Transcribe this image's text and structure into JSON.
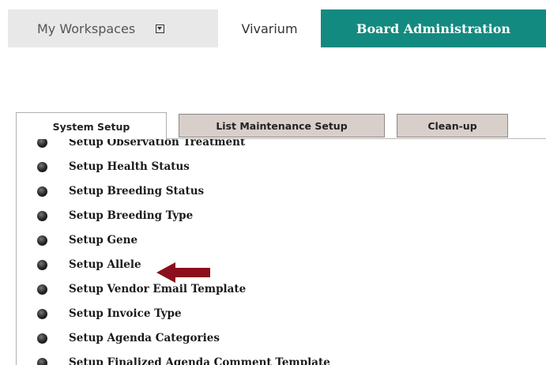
{
  "topnav": {
    "workspaces_label": "My Workspaces",
    "workspaces_icon": "dropdown-icon",
    "vivarium_label": "Vivarium",
    "board_label": "Board Administration",
    "board_color": "#138a80"
  },
  "tabs": [
    {
      "label": "System Setup",
      "active": true
    },
    {
      "label": "List Maintenance Setup",
      "active": false
    },
    {
      "label": "Clean-up",
      "active": false
    }
  ],
  "list": {
    "items": [
      {
        "label": "Setup Observation Treatment"
      },
      {
        "label": "Setup Health Status"
      },
      {
        "label": "Setup Breeding Status"
      },
      {
        "label": "Setup Breeding Type"
      },
      {
        "label": "Setup Gene"
      },
      {
        "label": "Setup Allele"
      },
      {
        "label": "Setup Vendor Email Template"
      },
      {
        "label": "Setup Invoice Type"
      },
      {
        "label": "Setup Agenda Categories"
      },
      {
        "label": "Setup Finalized Agenda Comment Template"
      }
    ]
  },
  "annotation": {
    "icon": "left-arrow-icon",
    "color": "#8b0f1c"
  }
}
